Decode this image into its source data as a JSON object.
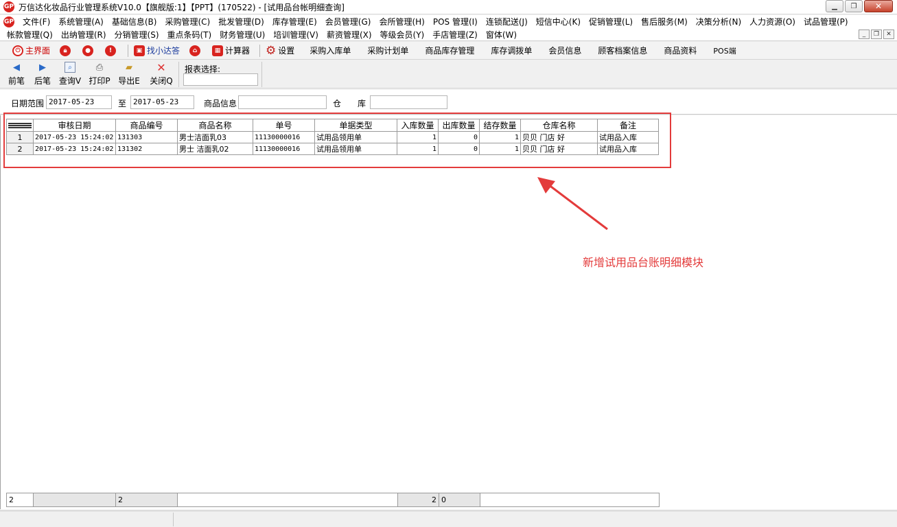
{
  "window": {
    "logo_text": "GP",
    "title": "万信达化妆品行业管理系统V10.0【旗舰版:1】【PPT】(170522) - [试用品台帐明细查询]"
  },
  "menu": {
    "row1": [
      "文件(F)",
      "系统管理(A)",
      "基础信息(B)",
      "采购管理(C)",
      "批发管理(D)",
      "库存管理(E)",
      "会员管理(G)",
      "会所管理(H)",
      "POS 管理(I)",
      "连锁配送(J)",
      "短信中心(K)",
      "促销管理(L)",
      "售后服务(M)",
      "决策分析(N)",
      "人力资源(O)",
      "试品管理(P)"
    ],
    "row2": [
      "帐款管理(Q)",
      "出纳管理(R)",
      "分销管理(S)",
      "重点条码(T)",
      "财务管理(U)",
      "培训管理(V)",
      "薪资管理(X)",
      "等级会员(Y)",
      "手店管理(Z)",
      "窗体(W)"
    ]
  },
  "quickbar": {
    "main": "主界面",
    "find": "找小达答",
    "calculator": "计算器",
    "settings": "设置",
    "links": [
      "采购入库单",
      "采购计划单",
      "商品库存管理",
      "库存调拨单",
      "会员信息",
      "顾客档案信息",
      "商品资料",
      "POS端"
    ]
  },
  "actions": {
    "prev": "前笔",
    "next": "后笔",
    "query": "查询V",
    "print": "打印P",
    "export": "导出E",
    "close": "关闭Q",
    "report_label": "报表选择:"
  },
  "filters": {
    "date_label": "日期范围",
    "date_from": "2017-05-23",
    "to_label": "至",
    "date_to": "2017-05-23",
    "product_label": "商品信息",
    "product_value": "",
    "warehouse_label": "仓　　库",
    "warehouse_value": ""
  },
  "table": {
    "columns": [
      "审核日期",
      "商品编号",
      "商品名称",
      "单号",
      "单据类型",
      "入库数量",
      "出库数量",
      "结存数量",
      "仓库名称",
      "备注"
    ],
    "rows": [
      {
        "num": "1",
        "date": "2017-05-23 15:24:02",
        "code": "131303",
        "name": "男士洁面乳03",
        "order": "11130000016",
        "type": "试用品领用单",
        "in": "1",
        "out": "0",
        "balance": "1",
        "warehouse": "贝贝 门店 好",
        "remark": "试用品入库"
      },
      {
        "num": "2",
        "date": "2017-05-23 15:24:02",
        "code": "131302",
        "name": "男士 洁面乳02",
        "order": "11130000016",
        "type": "试用品领用单",
        "in": "1",
        "out": "0",
        "balance": "1",
        "warehouse": "贝贝 门店 好",
        "remark": "试用品入库"
      }
    ]
  },
  "summary": {
    "row_count": "2",
    "code_count": "2",
    "in_total": "2",
    "out_total": "0"
  },
  "annotation": {
    "text": "新增试用品台账明细模块",
    "color": "#e33b3b"
  }
}
